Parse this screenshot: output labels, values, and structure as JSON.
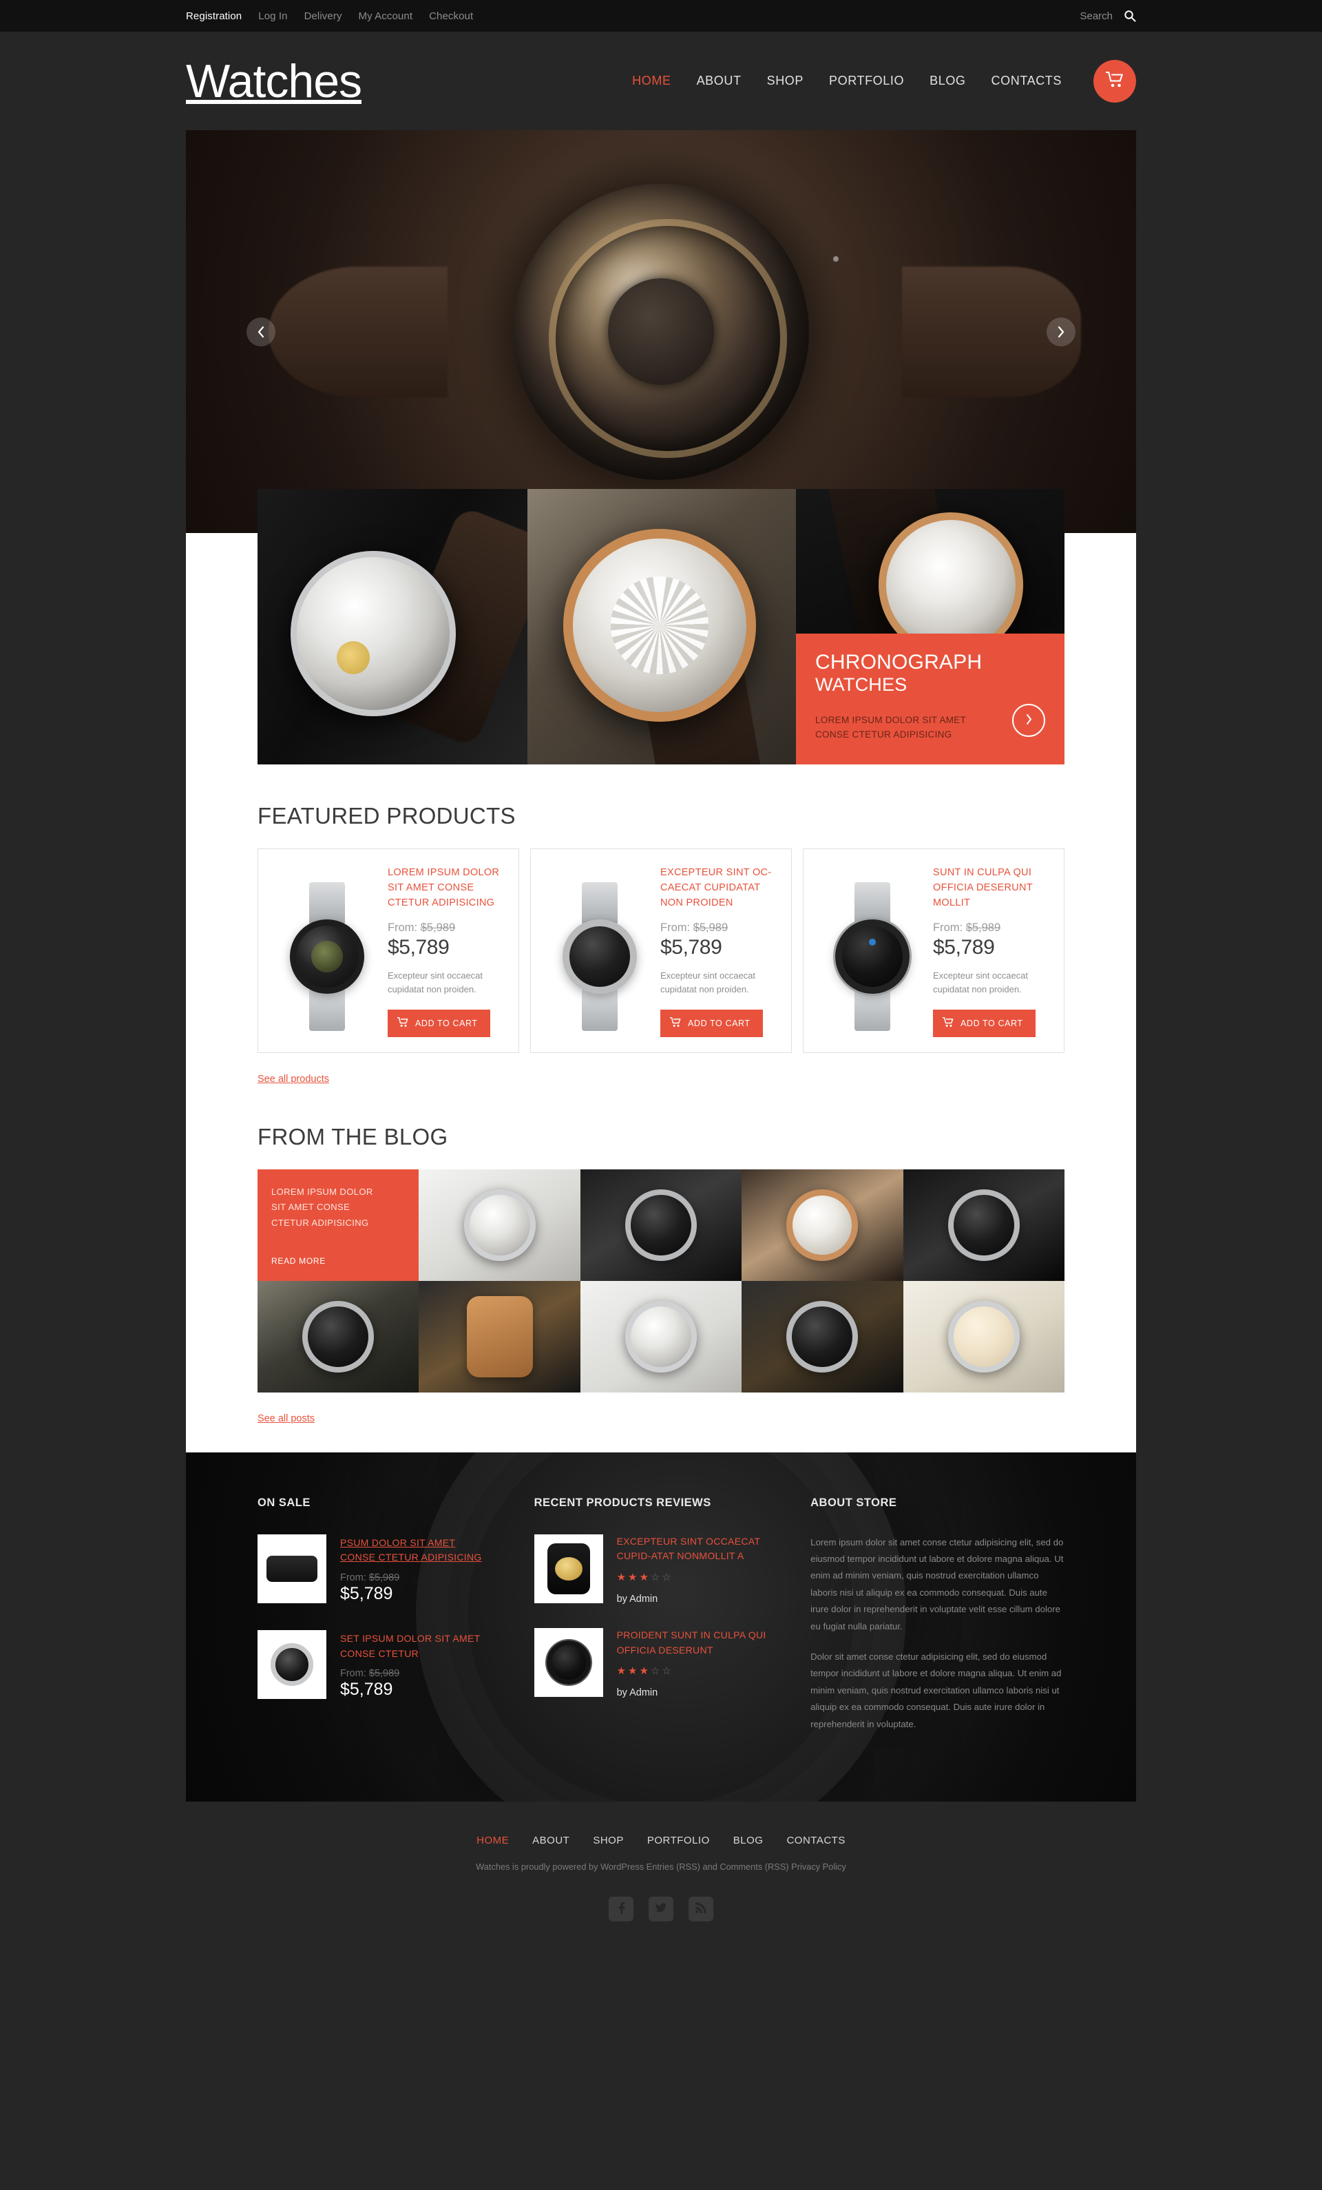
{
  "topbar": {
    "links": [
      {
        "label": "Registration",
        "active": true
      },
      {
        "label": "Log In",
        "active": false
      },
      {
        "label": "Delivery",
        "active": false
      },
      {
        "label": "My Account",
        "active": false
      },
      {
        "label": "Checkout",
        "active": false
      }
    ],
    "search_placeholder": "Search",
    "search_value": "",
    "search_icon": "search-icon"
  },
  "header": {
    "logo": "Watches",
    "nav": [
      {
        "label": "HOME",
        "active": true
      },
      {
        "label": "ABOUT",
        "active": false
      },
      {
        "label": "SHOP",
        "active": false
      },
      {
        "label": "PORTFOLIO",
        "active": false
      },
      {
        "label": "BLOG",
        "active": false
      },
      {
        "label": "CONTACTS",
        "active": false
      }
    ],
    "cart_icon": "shopping-cart-icon"
  },
  "slider": {
    "prev_icon": "chevron-left-icon",
    "next_icon": "chevron-right-icon"
  },
  "promo": {
    "title_line1": "CHRONOGRAPH",
    "title_line2": "WATCHES",
    "text_line1": "LOREM IPSUM DOLOR SIT AMET",
    "text_line2": "CONSE CTETUR ADIPISICING",
    "arrow_icon": "chevron-right-icon"
  },
  "featured": {
    "title": "FEATURED PRODUCTS",
    "see_all": "See all products",
    "cart_button_label": "ADD TO CART",
    "cart_button_icon": "shopping-cart-icon",
    "products": [
      {
        "name": "LOREM IPSUM DOLOR SIT AMET CONSE CTETUR ADIPISICING",
        "from_label": "From:",
        "old_price": "$5,989",
        "price": "$5,789",
        "desc": "Excepteur sint occaecat cupidatat non proiden."
      },
      {
        "name": "EXCEPTEUR SINT OC-CAECAT CUPIDATAT NON PROIDEN",
        "from_label": "From:",
        "old_price": "$5,989",
        "price": "$5,789",
        "desc": "Excepteur sint occaecat cupidatat non proiden."
      },
      {
        "name": "SUNT IN CULPA QUI OFFICIA DESERUNT MOLLIT",
        "from_label": "From:",
        "old_price": "$5,989",
        "price": "$5,789",
        "desc": "Excepteur sint occaecat cupidatat non proiden."
      }
    ]
  },
  "blog": {
    "title": "FROM THE BLOG",
    "see_all": "See all posts",
    "feature": {
      "line1": "LOREM IPSUM DOLOR",
      "line2": "SIT AMET CONSE",
      "line3": "CTETUR ADIPISICING",
      "read_more": "READ MORE"
    }
  },
  "widgets": {
    "on_sale": {
      "title": "ON SALE",
      "items": [
        {
          "name": "PSUM DOLOR SIT AMET CONSE CTETUR ADIPISICING",
          "from_label": "From:",
          "old_price": "$5,989",
          "price": "$5,789"
        },
        {
          "name": "SET IPSUM DOLOR SIT AMET CONSE CTETUR",
          "from_label": "From:",
          "old_price": "$5,989",
          "price": "$5,789"
        }
      ]
    },
    "reviews": {
      "title": "RECENT PRODUCTS REVIEWS",
      "items": [
        {
          "name": "EXCEPTEUR SINT OCCAECAT CUPID-ATAT NONMOLLIT A",
          "rating": 2.5,
          "author": "by Admin"
        },
        {
          "name": "PROIDENT SUNT IN CULPA QUI OFFICIA DESERUNT",
          "rating": 2.5,
          "author": "by Admin"
        }
      ]
    },
    "about": {
      "title": "ABOUT STORE",
      "p1": "Lorem ipsum dolor sit amet conse ctetur adipisicing elit, sed do eiusmod tempor incididunt ut labore et dolore magna aliqua. Ut enim ad minim veniam, quis nostrud exercitation ullamco laboris nisi ut aliquip ex ea commodo consequat. Duis aute irure dolor in reprehenderit in voluptate velit esse cillum dolore eu fugiat nulla pariatur.",
      "p2": "Dolor sit amet conse ctetur adipisicing elit, sed do eiusmod tempor incididunt ut labore et dolore magna aliqua. Ut enim ad minim veniam, quis nostrud exercitation ullamco laboris nisi ut aliquip ex ea commodo consequat. Duis aute irure dolor in reprehenderit in voluptate."
    }
  },
  "footer": {
    "nav": [
      {
        "label": "HOME",
        "active": true
      },
      {
        "label": "ABOUT",
        "active": false
      },
      {
        "label": "SHOP",
        "active": false
      },
      {
        "label": "PORTFOLIO",
        "active": false
      },
      {
        "label": "BLOG",
        "active": false
      },
      {
        "label": "CONTACTS",
        "active": false
      }
    ],
    "copyright": "Watches is proudly powered by WordPress Entries (RSS) and Comments (RSS) Privacy Policy",
    "socials": [
      "facebook-icon",
      "twitter-icon",
      "rss-icon"
    ]
  },
  "colors": {
    "accent": "#e8523c",
    "header_bg": "#262626",
    "topbar_bg": "#111111",
    "footer_bg": "#141414"
  }
}
